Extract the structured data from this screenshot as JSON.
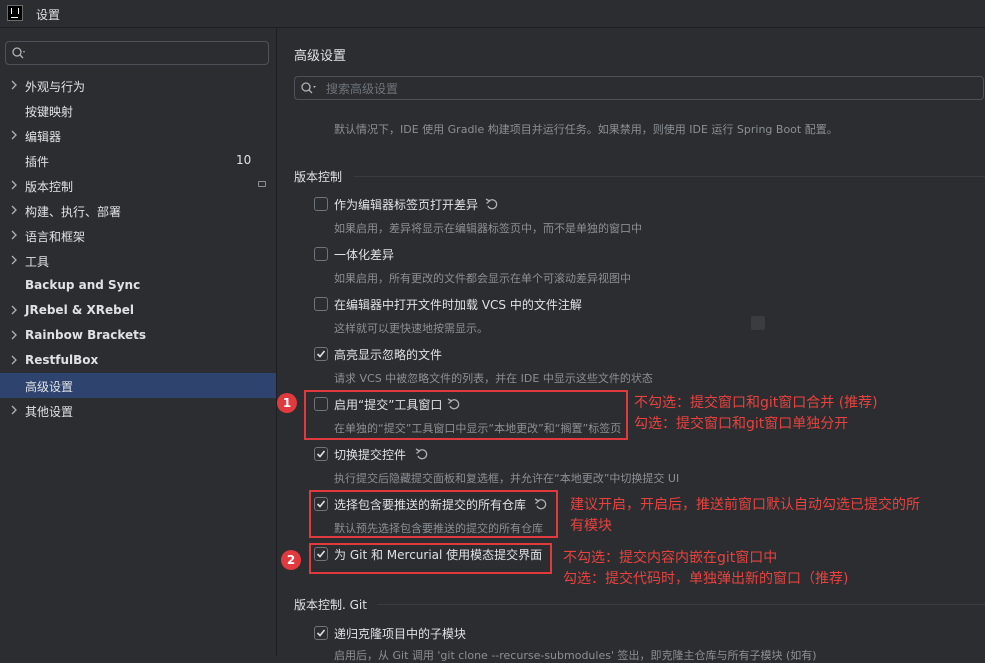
{
  "window": {
    "title": "设置"
  },
  "sidebar": {
    "search_value": "",
    "items": [
      {
        "label": "外观与行为",
        "has_chevron": true
      },
      {
        "label": "按键映射",
        "has_chevron": false
      },
      {
        "label": "编辑器",
        "has_chevron": true
      },
      {
        "label": "插件",
        "has_chevron": false,
        "badge": "10"
      },
      {
        "label": "版本控制",
        "has_chevron": true
      },
      {
        "label": "构建、执行、部署",
        "has_chevron": true
      },
      {
        "label": "语言和框架",
        "has_chevron": true
      },
      {
        "label": "工具",
        "has_chevron": true
      },
      {
        "label": "Backup and Sync",
        "has_chevron": false
      },
      {
        "label": "JRebel & XRebel",
        "has_chevron": true
      },
      {
        "label": "Rainbow Brackets",
        "has_chevron": true
      },
      {
        "label": "RestfulBox",
        "has_chevron": true
      },
      {
        "label": "高级设置",
        "has_chevron": false,
        "selected": true
      },
      {
        "label": "其他设置",
        "has_chevron": true
      }
    ]
  },
  "main": {
    "title": "高级设置",
    "search_placeholder": "搜索高级设置",
    "gradle_desc": "默认情况下，IDE 使用 Gradle 构建项目并运行任务。如果禁用，则使用 IDE 运行 Spring Boot 配置。",
    "vcs_section": "版本控制",
    "options": [
      {
        "label": "作为编辑器标签页打开差异",
        "desc": "如果启用，差异将显示在编辑器标签页中，而不是单独的窗口中",
        "checked": false
      },
      {
        "label": "一体化差异",
        "desc": "如果启用，所有更改的文件都会显示在单个可滚动差异视图中",
        "checked": false
      },
      {
        "label": "在编辑器中打开文件时加载 VCS 中的文件注解",
        "desc": "这样就可以更快速地按需显示。",
        "checked": false
      },
      {
        "label": "高亮显示忽略的文件",
        "desc": "请求 VCS 中被忽略文件的列表，并在 IDE 中显示这些文件的状态",
        "checked": true
      },
      {
        "label": "启用“提交”工具窗口",
        "desc": "在单独的“提交”工具窗口中显示“本地更改”和“搁置”标签页",
        "checked": false
      },
      {
        "label": "切换提交控件",
        "desc": "执行提交后隐藏提交面板和复选框，并允许在“本地更改”中切换提交 UI",
        "checked": true
      },
      {
        "label": "选择包含要推送的新提交的所有仓库",
        "desc": "默认预先选择包含要推送的提交的所有仓库",
        "checked": true
      },
      {
        "label": "为 Git 和 Mercurial 使用模态提交界面",
        "desc": "",
        "checked": true
      }
    ],
    "git_section": "版本控制. Git",
    "git_options": [
      {
        "label": "递归克隆项目中的子模块",
        "desc": "启用后，从 Git 调用 'git clone --recurse-submodules' 签出，即克隆主仓库与所有子模块 (如有)",
        "checked": true
      }
    ]
  },
  "annotations": {
    "badge1": "1",
    "badge2": "2",
    "note1_line1": "不勾选：提交窗口和git窗口合并 (推荐)",
    "note1_line2": "勾选：提交窗口和git窗口单独分开",
    "note_repo_line1": "建议开启，开启后，推送前窗口默认自动勾选已提交的所",
    "note_repo_line2": "有模块",
    "note2_line1": "不勾选：提交内容内嵌在git窗口中",
    "note2_line2": "勾选：提交代码时，单独弹出新的窗口（推荐)",
    "color": "#e8423f"
  },
  "colors": {
    "accent_selected": "#2e436e",
    "background": "#2b2d30"
  }
}
